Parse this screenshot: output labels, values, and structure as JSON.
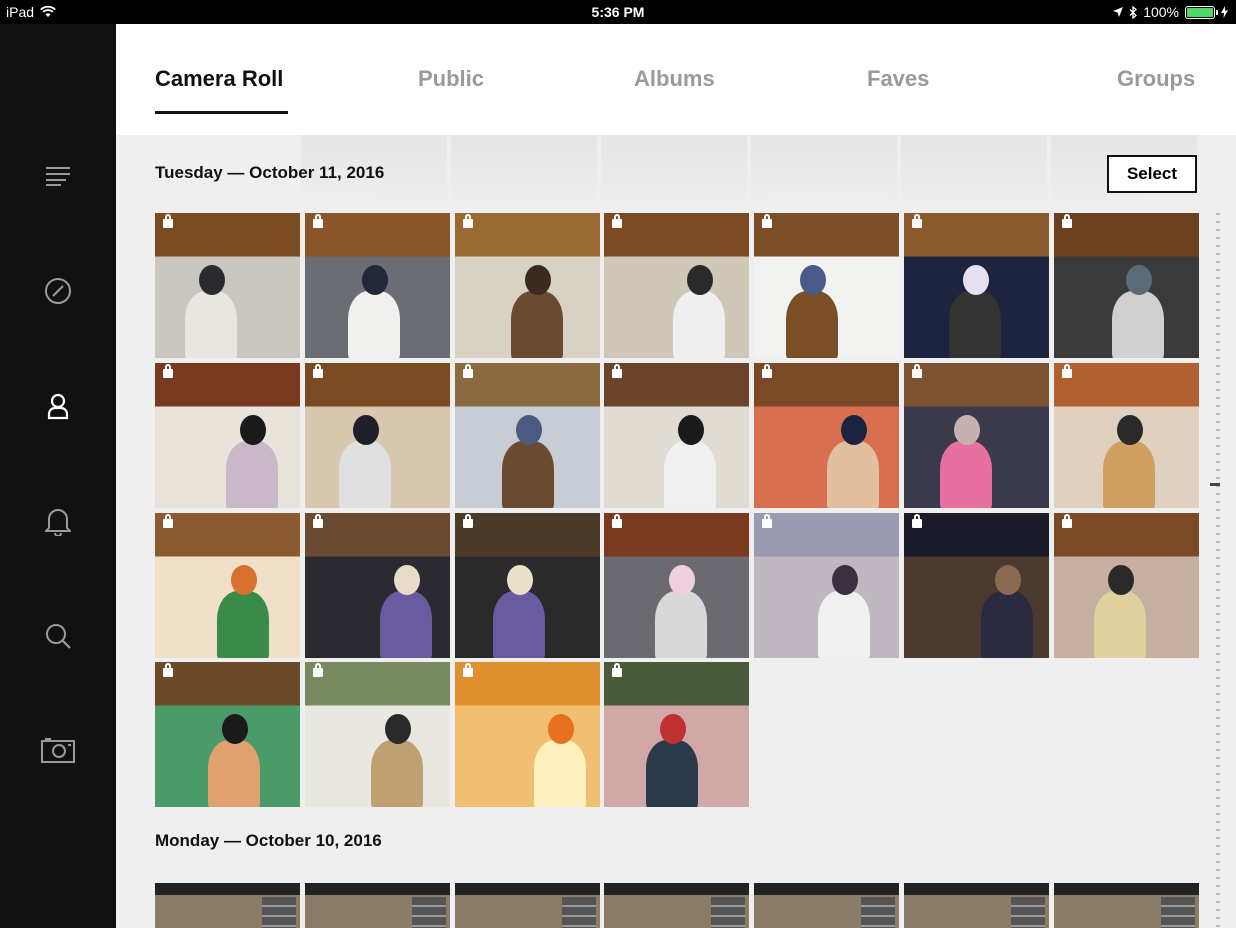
{
  "status_bar": {
    "device": "iPad",
    "time": "5:36 PM",
    "battery": "100%"
  },
  "sidebar": {
    "items": [
      {
        "icon": "menu-lines-icon"
      },
      {
        "icon": "compass-icon"
      },
      {
        "icon": "profile-icon",
        "active": true
      },
      {
        "icon": "bell-icon"
      },
      {
        "icon": "search-icon"
      },
      {
        "icon": "camera-icon"
      }
    ]
  },
  "tabs": [
    {
      "label": "Camera Roll",
      "active": true
    },
    {
      "label": "Public"
    },
    {
      "label": "Albums"
    },
    {
      "label": "Faves"
    },
    {
      "label": "Groups"
    }
  ],
  "sections": [
    {
      "date": "Tuesday — October 11, 2016",
      "photo_count": 25
    },
    {
      "date": "Monday — October 10, 2016"
    }
  ],
  "select_label": "Select",
  "colors": {
    "accent": "#111111",
    "tab_inactive": "#9a9a9a",
    "content_bg": "#efefef",
    "sidebar_bg": "#111111",
    "battery": "#4cd964"
  }
}
